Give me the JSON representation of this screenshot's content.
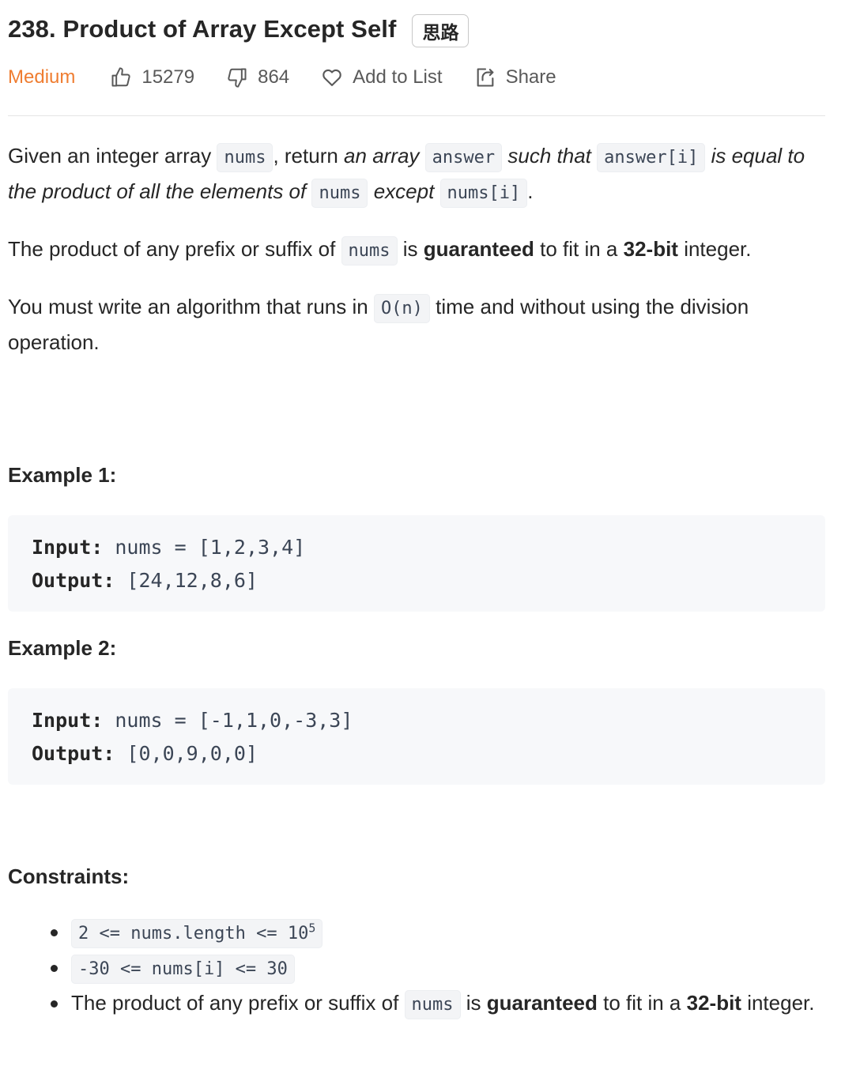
{
  "title": "238. Product of Array Except Self",
  "tag_label": "思路",
  "meta": {
    "difficulty": "Medium",
    "likes": "15279",
    "dislikes": "864",
    "add_to_list": "Add to List",
    "share": "Share"
  },
  "description": {
    "p1": {
      "t1": "Given an integer array ",
      "c1": "nums",
      "t2": ", return ",
      "i1": "an array",
      "c2": "answer",
      "i2": "such that",
      "c3": "answer[i]",
      "i3": "is equal to the product of all the elements of",
      "c4": "nums",
      "i4": "except",
      "c5": "nums[i]",
      "t3": "."
    },
    "p2": {
      "t1": "The product of any prefix or suffix of ",
      "c1": "nums",
      "t2": " is ",
      "b1": "guaranteed",
      "t3": " to fit in a ",
      "b2": "32-bit",
      "t4": " integer."
    },
    "p3": {
      "t1": "You must write an algorithm that runs in ",
      "c1": "O(n)",
      "t2": " time and without using the division operation."
    }
  },
  "examples": [
    {
      "title": "Example 1:",
      "input_label": "Input:",
      "input_value": "nums = [1,2,3,4]",
      "output_label": "Output:",
      "output_value": "[24,12,8,6]"
    },
    {
      "title": "Example 2:",
      "input_label": "Input:",
      "input_value": "nums = [-1,1,0,-3,3]",
      "output_label": "Output:",
      "output_value": "[0,0,9,0,0]"
    }
  ],
  "constraints": {
    "title": "Constraints:",
    "c1": {
      "code": "2 <= nums.length <= 10",
      "sup": "5"
    },
    "c2": {
      "code": "-30 <= nums[i] <= 30"
    },
    "c3": {
      "t1": "The product of any prefix or suffix of ",
      "c1": "nums",
      "t2": " is ",
      "b1": "guaranteed",
      "t3": " to fit in a ",
      "b2": "32-bit",
      "t4": " integer."
    }
  },
  "colors": {
    "difficulty_medium": "#ef7d31",
    "text": "#262626",
    "meta_text": "#595959",
    "code_bg": "#f3f4f6",
    "pre_bg": "#f7f8fa"
  },
  "icons": {
    "likes": "thumbs-up-icon",
    "dislikes": "thumbs-down-icon",
    "add_to_list": "heart-icon",
    "share": "share-icon"
  }
}
